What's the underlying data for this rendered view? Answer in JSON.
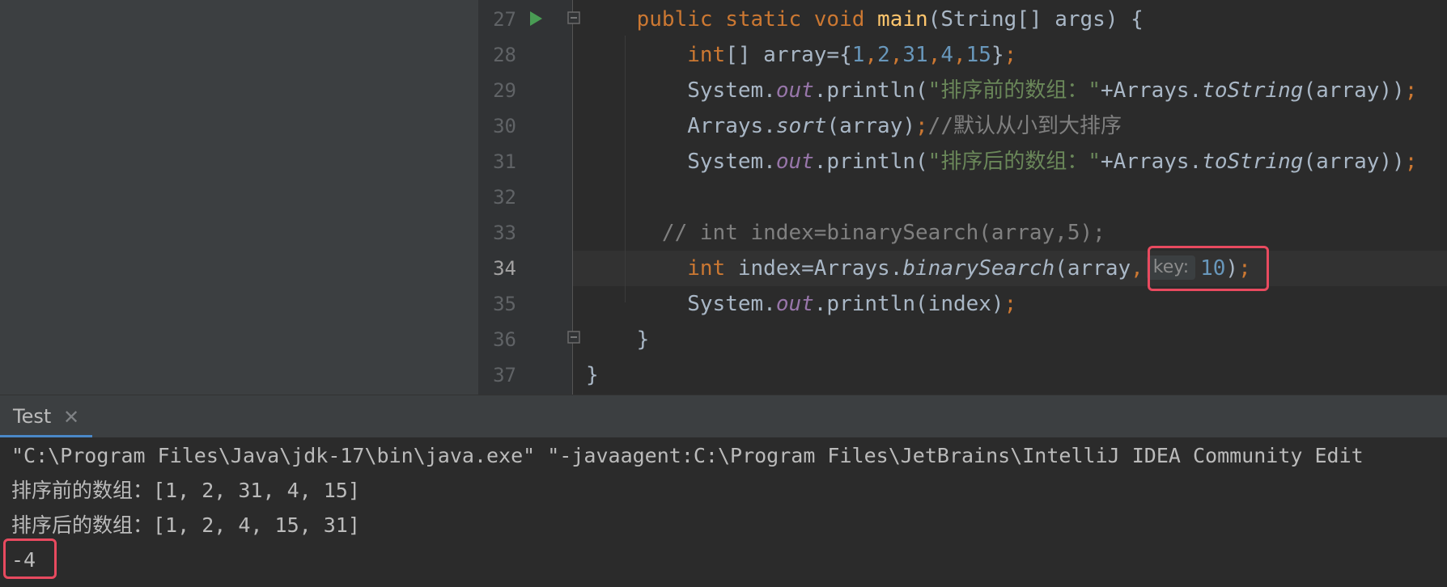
{
  "editor": {
    "line_numbers": [
      "27",
      "28",
      "29",
      "30",
      "31",
      "32",
      "33",
      "34",
      "35",
      "36",
      "37"
    ],
    "active_line": "34",
    "parameter_hint": "key:"
  },
  "run_panel": {
    "tab_label": "Test",
    "output": [
      "\"C:\\Program Files\\Java\\jdk-17\\bin\\java.exe\" \"-javaagent:C:\\Program Files\\JetBrains\\IntelliJ IDEA Community Edit",
      "排序前的数组：[1, 2, 31, 4, 15]",
      "排序后的数组：[1, 2, 4, 15, 31]",
      "-4"
    ]
  },
  "colors": {
    "background": "#2b2b2b",
    "keyword": "#cc7832",
    "string": "#6a8759",
    "number": "#6897bb",
    "method": "#ffc66d",
    "field": "#9876aa",
    "comment": "#808080",
    "highlight_box": "#e84a5f"
  }
}
